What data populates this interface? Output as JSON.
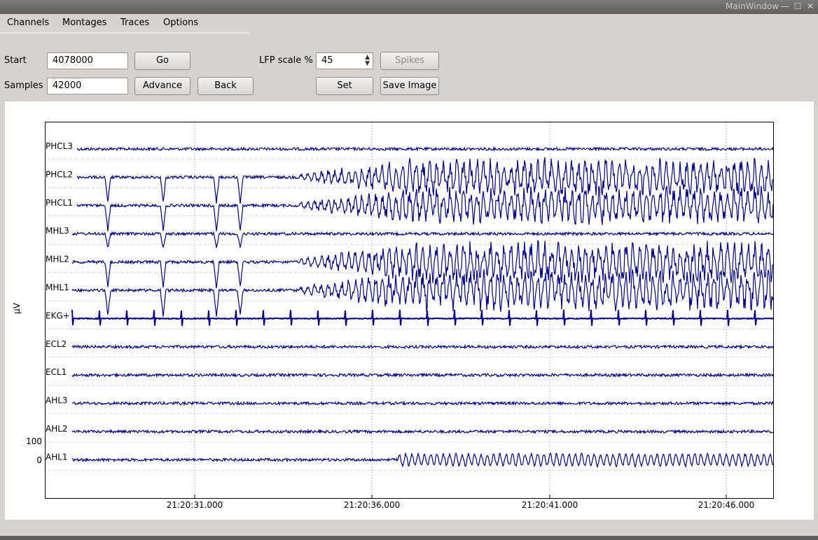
{
  "window": {
    "title": "MainWindow",
    "buttons": {
      "minimize": "—",
      "maximize": "☐",
      "close": "✕"
    }
  },
  "menu": {
    "items": [
      "Channels",
      "Montages",
      "Traces",
      "Options"
    ]
  },
  "controls": {
    "start_label": "Start",
    "start_value": "4078000",
    "samples_label": "Samples",
    "samples_value": "42000",
    "go_label": "Go",
    "advance_label": "Advance",
    "back_label": "Back",
    "lfp_label": "LFP scale %",
    "lfp_value": "45",
    "spikes_label": "Spikes",
    "set_label": "Set",
    "save_image_label": "Save Image"
  },
  "chart_data": {
    "type": "line",
    "ylabel": "μV",
    "channels": [
      "PHCL3",
      "PHCL2",
      "PHCL1",
      "MHL3",
      "MHL2",
      "MHL1",
      "EKG+",
      "ECL2",
      "ECL1",
      "AHL3",
      "AHL2",
      "AHL1"
    ],
    "x_ticks": [
      "21:20:31.000",
      "21:20:36.000",
      "21:20:41.000",
      "21:20:46.000"
    ],
    "scale_bar": {
      "top_label": "100",
      "bottom_label": "0"
    },
    "grid": true,
    "line_color": "#00008b"
  }
}
